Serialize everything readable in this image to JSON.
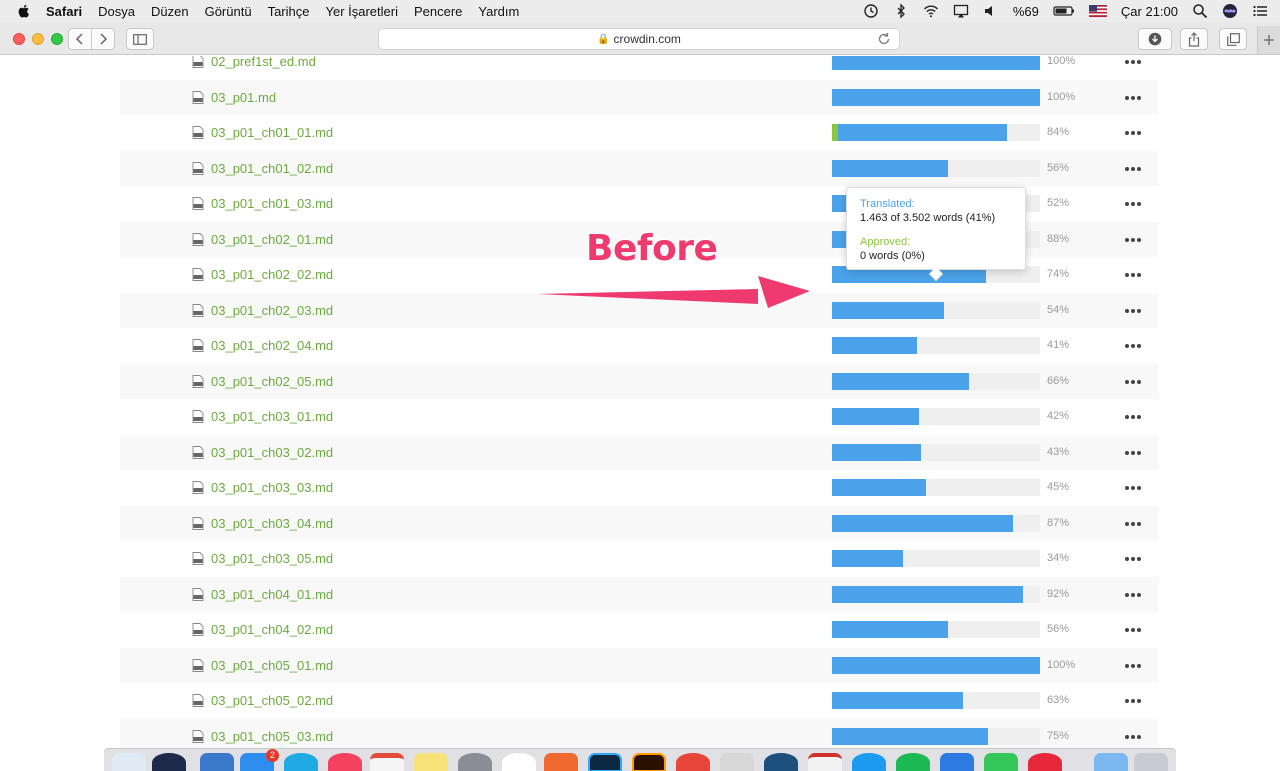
{
  "menubar": {
    "app_name": "Safari",
    "menus": [
      "Dosya",
      "Düzen",
      "Görüntü",
      "Tarihçe",
      "Yer İşaretleri",
      "Pencere",
      "Yardım"
    ],
    "battery": "%69",
    "clock": "Çar 21:00"
  },
  "browser": {
    "url": "crowdin.com"
  },
  "files": [
    {
      "name": "02_pref1st_ed.md",
      "percent": "100%",
      "translated": 1.0,
      "approved": 0
    },
    {
      "name": "03_p01.md",
      "percent": "100%",
      "translated": 1.0,
      "approved": 0
    },
    {
      "name": "03_p01_ch01_01.md",
      "percent": "84%",
      "translated": 0.84,
      "approved": 0.03
    },
    {
      "name": "03_p01_ch01_02.md",
      "percent": "56%",
      "translated": 0.56,
      "approved": 0
    },
    {
      "name": "03_p01_ch01_03.md",
      "percent": "52%",
      "translated": 0.52,
      "approved": 0
    },
    {
      "name": "03_p01_ch02_01.md",
      "percent": "88%",
      "translated": 0.88,
      "approved": 0
    },
    {
      "name": "03_p01_ch02_02.md",
      "percent": "74%",
      "translated": 0.74,
      "approved": 0
    },
    {
      "name": "03_p01_ch02_03.md",
      "percent": "54%",
      "translated": 0.54,
      "approved": 0
    },
    {
      "name": "03_p01_ch02_04.md",
      "percent": "41%",
      "translated": 0.41,
      "approved": 0
    },
    {
      "name": "03_p01_ch02_05.md",
      "percent": "66%",
      "translated": 0.66,
      "approved": 0
    },
    {
      "name": "03_p01_ch03_01.md",
      "percent": "42%",
      "translated": 0.42,
      "approved": 0
    },
    {
      "name": "03_p01_ch03_02.md",
      "percent": "43%",
      "translated": 0.43,
      "approved": 0
    },
    {
      "name": "03_p01_ch03_03.md",
      "percent": "45%",
      "translated": 0.45,
      "approved": 0
    },
    {
      "name": "03_p01_ch03_04.md",
      "percent": "87%",
      "translated": 0.87,
      "approved": 0
    },
    {
      "name": "03_p01_ch03_05.md",
      "percent": "34%",
      "translated": 0.34,
      "approved": 0
    },
    {
      "name": "03_p01_ch04_01.md",
      "percent": "92%",
      "translated": 0.92,
      "approved": 0
    },
    {
      "name": "03_p01_ch04_02.md",
      "percent": "56%",
      "translated": 0.56,
      "approved": 0
    },
    {
      "name": "03_p01_ch05_01.md",
      "percent": "100%",
      "translated": 1.0,
      "approved": 0
    },
    {
      "name": "03_p01_ch05_02.md",
      "percent": "63%",
      "translated": 0.63,
      "approved": 0
    },
    {
      "name": "03_p01_ch05_03.md",
      "percent": "75%",
      "translated": 0.75,
      "approved": 0
    }
  ],
  "tooltip": {
    "translated_label": "Translated:",
    "translated_value": "1.463 of 3.502 words (41%)",
    "approved_label": "Approved:",
    "approved_value": "0 words (0%)"
  },
  "annotation": {
    "text": "Before"
  },
  "dock": {
    "app_store_badge": "2"
  },
  "colors": {
    "file_link": "#6bab3e",
    "progress_translated": "#4aa3ea",
    "progress_approved": "#8cc63f",
    "annotation": "#ee3a6f"
  }
}
